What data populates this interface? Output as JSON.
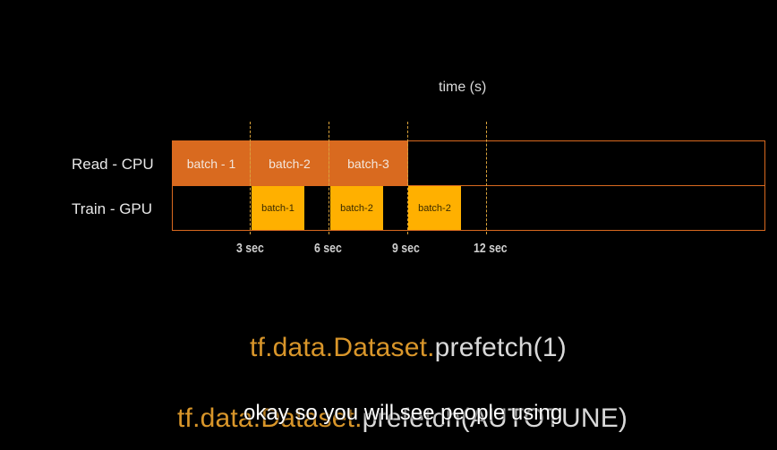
{
  "axis_title": "time (s)",
  "rows": {
    "cpu": "Read - CPU",
    "gpu": "Train - GPU"
  },
  "cpu_blocks": [
    "batch - 1",
    "batch-2",
    "batch-3"
  ],
  "gpu_blocks": [
    "batch-1",
    "batch-2",
    "batch-2"
  ],
  "ticks": [
    "3 sec",
    "6 sec",
    "9 sec",
    "12 sec"
  ],
  "code_line1": {
    "tf": "tf.data.Dataset.",
    "call": "prefetch(",
    "arg": "1",
    "close": ")"
  },
  "code_line2": {
    "tf": "tf.data.Dataset.",
    "call": "prefetch(AUTOTUNE)"
  },
  "subtitle": "okay so you will see people using"
}
